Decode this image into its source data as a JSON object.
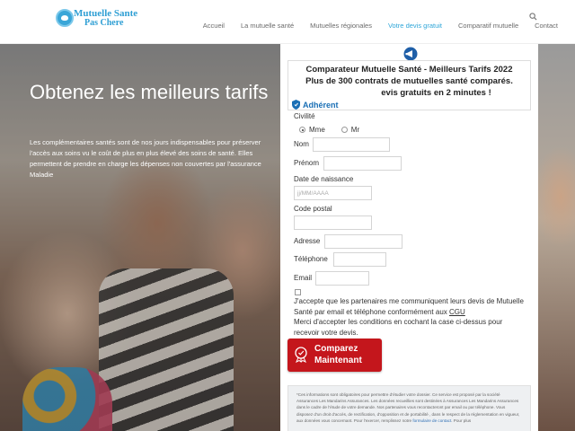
{
  "brand": {
    "name_line1": "Mutuelle Sante",
    "name_line2": "Pas Chere"
  },
  "nav": [
    {
      "label": "Accueil",
      "active": false
    },
    {
      "label": "La mutuelle santé",
      "active": false
    },
    {
      "label": "Mutuelles régionales",
      "active": false
    },
    {
      "label": "Votre devis gratuit",
      "active": true
    },
    {
      "label": "Comparatif mutuelle",
      "active": false
    },
    {
      "label": "Contact",
      "active": false
    }
  ],
  "hero": {
    "title": "Obtenez les meilleurs tarifs",
    "text": "Les complémentaires santés sont de nos jours indispensables pour préserver l'accès aux soins vu le coût de plus en plus élevé des soins de santé. Elles permettent de prendre en charge les dépenses non couvertes par l'assurance Maladie"
  },
  "promo": {
    "title": "Comparateur Mutuelle Santé - Meilleurs Tarifs 2022",
    "subtitle": "Plus de 300 contrats de mutuelles santé comparés.",
    "subtitle2": "evis gratuits en 2 minutes !",
    "badge": "Adhérent"
  },
  "form": {
    "civility_label": "Civilité",
    "opt_mme": "Mme",
    "opt_mr": "Mr",
    "nom_label": "Nom",
    "prenom_label": "Prénom",
    "dob_label": "Date de naissance",
    "dob_placeholder": "jj/MM/AAAA",
    "cp_label": "Code postal",
    "adresse_label": "Adresse",
    "tel_label": "Téléphone",
    "email_label": "Email",
    "consent_part1": "J'accepte que les partenaires me communiquent leurs devis de Mutuelle Santé par email et téléphone conformément aux ",
    "consent_cgu": "CGU",
    "consent_part2": "Merci d'accepter les conditions en cochant la case ci-dessus pour recevoir votre devis.",
    "submit_line1": "Comparez",
    "submit_line2": "Maintenant"
  },
  "disclaimer": {
    "text": "*Ces informations sont obligatoires pour permettre d'étudier votre dossier. Ce service est proposé par la société Assurances Les Mandarins Assurances. Les données recueillies sont destinées à Assurances Les Mandarins Assurances dans le cadre de l'étude de votre demande. Nos partenaires vous recontacteront par email ou par téléphone. Vous disposez d'un droit d'accès, de rectification, d'opposition et de portabilité , dans le respect de la réglementation en vigueur, aux données vous concernant. Pour l'exercer, remplissez notre ",
    "link": "formulaire de contact",
    "text_end": ". Pour plus"
  }
}
